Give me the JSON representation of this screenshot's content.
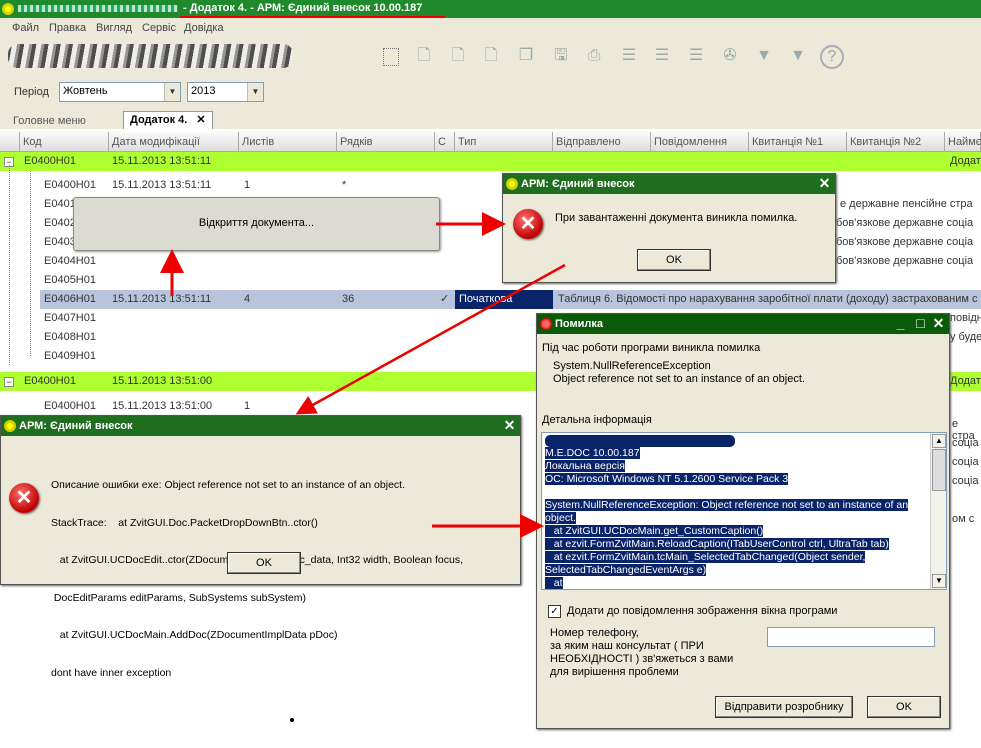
{
  "window": {
    "title": "- Додаток 4. - АРМ: Єдиний внесок 10.00.187",
    "accent": "#1f8a2b"
  },
  "menu": [
    {
      "label": "Файл"
    },
    {
      "label": "Правка"
    },
    {
      "label": "Вигляд"
    },
    {
      "label": "Сервіс"
    },
    {
      "label": "Довідка"
    }
  ],
  "toolbar_icons": [
    "select-icon",
    "add-doc-icon",
    "edit-doc-icon",
    "delete-doc-icon",
    "copy-doc-icon",
    "save-icon",
    "print-icon",
    "add-row-icon",
    "list-icon",
    "remove-row-icon",
    "binoculars-icon",
    "filter-icon",
    "clear-filter-icon",
    "help-icon"
  ],
  "period": {
    "label": "Період",
    "month": "Жовтень",
    "year": "2013"
  },
  "tabs": [
    {
      "label": "Головне меню"
    },
    {
      "label": "Додаток 4."
    }
  ],
  "columns": [
    "Код",
    "Дата модифікації",
    "Листів",
    "Рядків",
    "С",
    "Тип",
    "Відправлено",
    "Повідомлення",
    "Квитанція №1",
    "Квитанція №2",
    "Наймє"
  ],
  "rows": [
    {
      "code": "E0400H01",
      "date": "15.11.2013 13:51:11",
      "sheets": "",
      "lines": "",
      "check": "",
      "type": "",
      "tail": "Додат",
      "kind": "group"
    },
    {
      "code": "E0400H01",
      "date": "15.11.2013 13:51:11",
      "sheets": "1",
      "lines": "*",
      "check": "",
      "type": "",
      "tail": "",
      "kind": "child"
    },
    {
      "code": "E0401",
      "date": "",
      "sheets": "",
      "lines": "",
      "check": "",
      "type": "",
      "tail": "е державне пенсійне стра",
      "kind": "child"
    },
    {
      "code": "E0402",
      "date": "",
      "sheets": "",
      "lines": "",
      "check": "",
      "type": "",
      "tail": "бов'язкове державне соціа",
      "kind": "child"
    },
    {
      "code": "E0403",
      "date": "",
      "sheets": "",
      "lines": "",
      "check": "",
      "type": "",
      "tail": "бов'язкове державне соціа",
      "kind": "child"
    },
    {
      "code": "E0404H01",
      "date": "",
      "sheets": "",
      "lines": "",
      "check": "",
      "type": "",
      "tail": "бов'язкове державне соціа",
      "kind": "child"
    },
    {
      "code": "E0405H01",
      "date": "",
      "sheets": "",
      "lines": "",
      "check": "",
      "type": "",
      "tail": "",
      "kind": "child"
    },
    {
      "code": "E0406H01",
      "date": "15.11.2013 13:51:11",
      "sheets": "4",
      "lines": "36",
      "check": "✓",
      "type": "Початкова",
      "tail": "Таблиця 6. Відомості про нарахування заробітної плати (доходу) застрахованим с",
      "kind": "selected"
    },
    {
      "code": "E0407H01",
      "date": "",
      "sheets": "",
      "lines": "",
      "check": "",
      "type": "",
      "tail": "повідн",
      "kind": "child"
    },
    {
      "code": "E0408H01",
      "date": "",
      "sheets": "",
      "lines": "",
      "check": "",
      "type": "",
      "tail": "у буде",
      "kind": "child"
    },
    {
      "code": "E0409H01",
      "date": "",
      "sheets": "",
      "lines": "",
      "check": "",
      "type": "",
      "tail": "",
      "kind": "child"
    },
    {
      "code": "E0400H01",
      "date": "15.11.2013 13:51:00",
      "sheets": "",
      "lines": "",
      "check": "",
      "type": "",
      "tail": "Додат",
      "kind": "group"
    },
    {
      "code": "E0400H01",
      "date": "15.11.2013 13:51:00",
      "sheets": "1",
      "lines": "",
      "check": "",
      "type": "",
      "tail": "",
      "kind": "child"
    }
  ],
  "right_tails": [
    "е стра",
    "соціа",
    "соціа",
    "соціа",
    "ом с"
  ],
  "opening_box": {
    "text": "Відкриття документа..."
  },
  "dialog_load": {
    "title": "АРМ: Єдиний внесок",
    "message": "При завантаженні документа виникла помилка.",
    "ok": "OK"
  },
  "dialog_stack": {
    "title": "АРМ: Єдиний внесок",
    "lines": [
      "Описание ошибки exe: Object reference not set to an instance of an object.",
      "StackTrace:    at ZvitGUI.Doc.PacketDropDownBtn..ctor()",
      "   at ZvitGUI.UCDocEdit..ctor(ZDocumentImplData doc_data, Int32 width, Boolean focus,",
      " DocEditParams editParams, SubSystems subSystem)",
      "   at ZvitGUI.UCDocMain.AddDoc(ZDocumentImplData pDoc)",
      "dont have inner exception"
    ],
    "ok": "OK"
  },
  "dialog_error": {
    "title": "Помилка",
    "intro": "Під час роботи програми виникла помилка",
    "exception": "System.NullReferenceException",
    "exception_msg": "Object reference not set to an instance of an object.",
    "details_label": "Детальна інформація",
    "details_lines": [
      "M.E.DOC 10.00.187",
      "Локальна версія",
      " ОС: Microsoft Windows NT 5.1.2600 Service Pack 3",
      "",
      "System.NullReferenceException: Object reference not set to an instance of an",
      "object.",
      "   at ZvitGUI.UCDocMain.get_CustomCaption()",
      "   at ezvit.FormZvitMain.ReloadCaption(ITabUserControl ctrl, UltraTab tab)",
      "   at ezvit.FormZvitMain.tcMain_SelectedTabChanged(Object sender,",
      "SelectedTabChangedEventArgs e)",
      "   at"
    ],
    "checkbox_label": "Додати до повідомлення зображення вікна програми",
    "checkbox_checked": true,
    "phone_label_lines": [
      "Номер телефону,",
      "за яким наш консультат ( ПРИ",
      "НЕОБХІДНОСТІ ) зв'яжеться з вами",
      "для  вирішення проблеми"
    ],
    "phone_value": "",
    "send_button": "Відправити розробнику",
    "ok": "OK"
  }
}
